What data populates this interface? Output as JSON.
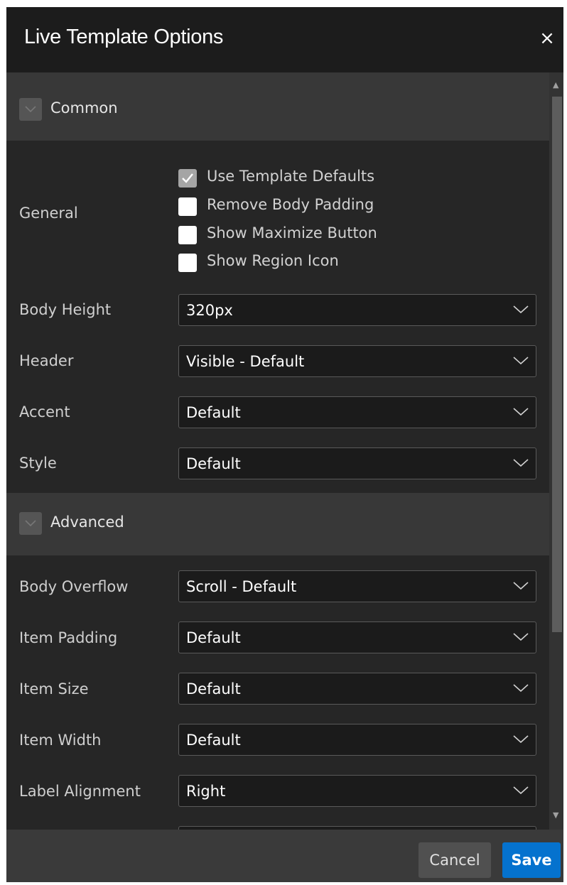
{
  "dialog": {
    "title": "Live Template Options",
    "close_glyph": "×",
    "close_icon": "close-icon"
  },
  "sections": {
    "common": {
      "label": "Common",
      "toggle_icon": "chevron-down-icon",
      "general": {
        "label": "General",
        "options": [
          {
            "label": "Use Template Defaults",
            "checked": true
          },
          {
            "label": "Remove Body Padding",
            "checked": false
          },
          {
            "label": "Show Maximize Button",
            "checked": false
          },
          {
            "label": "Show Region Icon",
            "checked": false
          }
        ]
      },
      "fields": [
        {
          "label": "Body Height",
          "value": "320px"
        },
        {
          "label": "Header",
          "value": "Visible - Default"
        },
        {
          "label": "Accent",
          "value": "Default"
        },
        {
          "label": "Style",
          "value": "Default"
        }
      ]
    },
    "advanced": {
      "label": "Advanced",
      "toggle_icon": "chevron-down-icon",
      "fields": [
        {
          "label": "Body Overflow",
          "value": "Scroll - Default"
        },
        {
          "label": "Item Padding",
          "value": "Default"
        },
        {
          "label": "Item Size",
          "value": "Default"
        },
        {
          "label": "Item Width",
          "value": "Default"
        },
        {
          "label": "Label Alignment",
          "value": "Right"
        },
        {
          "label": "",
          "value": ""
        }
      ]
    }
  },
  "scrollbar": {
    "up_glyph": "▲",
    "down_glyph": "▼"
  },
  "footer": {
    "cancel_label": "Cancel",
    "save_label": "Save"
  },
  "colors": {
    "dialog_bg": "#262626",
    "titlebar_bg": "#1c1c1c",
    "section_header_bg": "#383838",
    "footer_bg": "#3a3a3a",
    "primary_button": "#0572ce",
    "secondary_button": "#505050"
  }
}
